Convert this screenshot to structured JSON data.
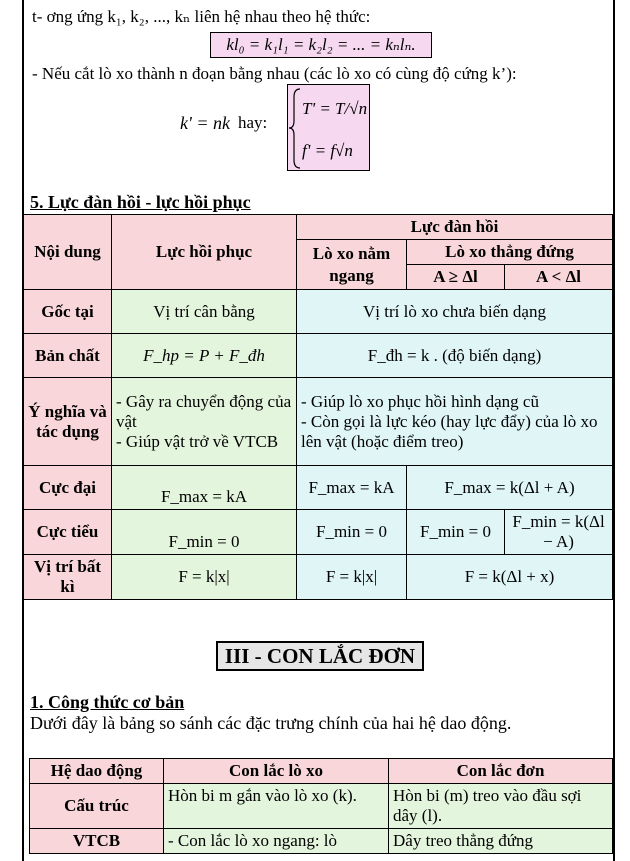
{
  "intro": {
    "relation_text": "t- ơng ứng k₁, k₂, ..., kₙ  liên hệ nhau theo hệ thức:",
    "formula": "kl₀ = k₁l₁ = k₂l₂ = ... = kₙlₙ.",
    "cut_text": "- Nếu cắt lò xo thành n đoạn bằng nhau (các lò xo có cùng độ cứng k’):",
    "kprime": "k' = nk",
    "hay": "hay:",
    "T_eq": "T' = T/√n",
    "f_eq": "f' = f√n"
  },
  "section5": {
    "heading": "5. Lực đàn hồi - lực hồi phục"
  },
  "table1": {
    "h_content": "Nội dung",
    "h_restoring": "Lực hồi phục",
    "h_elastic": "Lực đàn hồi",
    "h_horizontal": "Lò xo nằm ngang",
    "h_vertical": "Lò xo thẳng đứng",
    "h_a_ge": "A ≥ Δl",
    "h_a_lt": "A < Δl",
    "rows": {
      "origin": {
        "label": "Gốc tại",
        "restoring": "Vị trí cân bằng",
        "elastic": "Vị trí lò xo chưa biến dạng"
      },
      "nature": {
        "label": "Bản chất",
        "restoring": "F_hp = P + F_đh",
        "elastic": "F_đh = k . (độ biến dạng)"
      },
      "meaning": {
        "label": "Ý nghĩa và tác dụng",
        "restoring_1": "- Gây ra chuyển động của vật",
        "restoring_2": "- Giúp vật trở về VTCB",
        "elastic_1": "- Giúp lò xo phục hồi hình dạng cũ",
        "elastic_2": "- Còn gọi là lực kéo (hay lực đẩy) của lò xo lên vật (hoặc điểm treo)"
      },
      "max": {
        "label": "Cực đại",
        "restoring": "F_max = kA",
        "horizontal": "F_max = kA",
        "vertical": "F_max = k(Δl + A)"
      },
      "min": {
        "label": "Cực tiểu",
        "restoring": "F_min = 0",
        "horizontal": "F_min = 0",
        "ge": "F_min = 0",
        "lt": "F_min = k(Δl − A)"
      },
      "any": {
        "label": "Vị trí bất kì",
        "restoring": "F = k|x|",
        "horizontal": "F = k|x|",
        "vertical": "F = k(Δl + x)"
      }
    }
  },
  "section3": {
    "title": "III - CON LẮC ĐƠN"
  },
  "subsection1": {
    "heading": "1. Công thức cơ bản",
    "desc": "Dưới đây là bảng so sánh các đặc trưng chính của hai hệ dao động."
  },
  "table2": {
    "h_system": "Hệ dao động",
    "h_spring": "Con lắc lò xo",
    "h_pendulum": "Con lắc đơn",
    "structure": {
      "label": "Cấu trúc",
      "spring": "Hòn bi m gắn vào lò xo (k).",
      "pendulum": "Hòn bi (m) treo vào đầu sợi dây (l)."
    },
    "vtcb": {
      "label": "VTCB",
      "spring": "- Con lắc lò xo ngang: lò",
      "pendulum": "Dây treo thẳng đứng"
    }
  }
}
